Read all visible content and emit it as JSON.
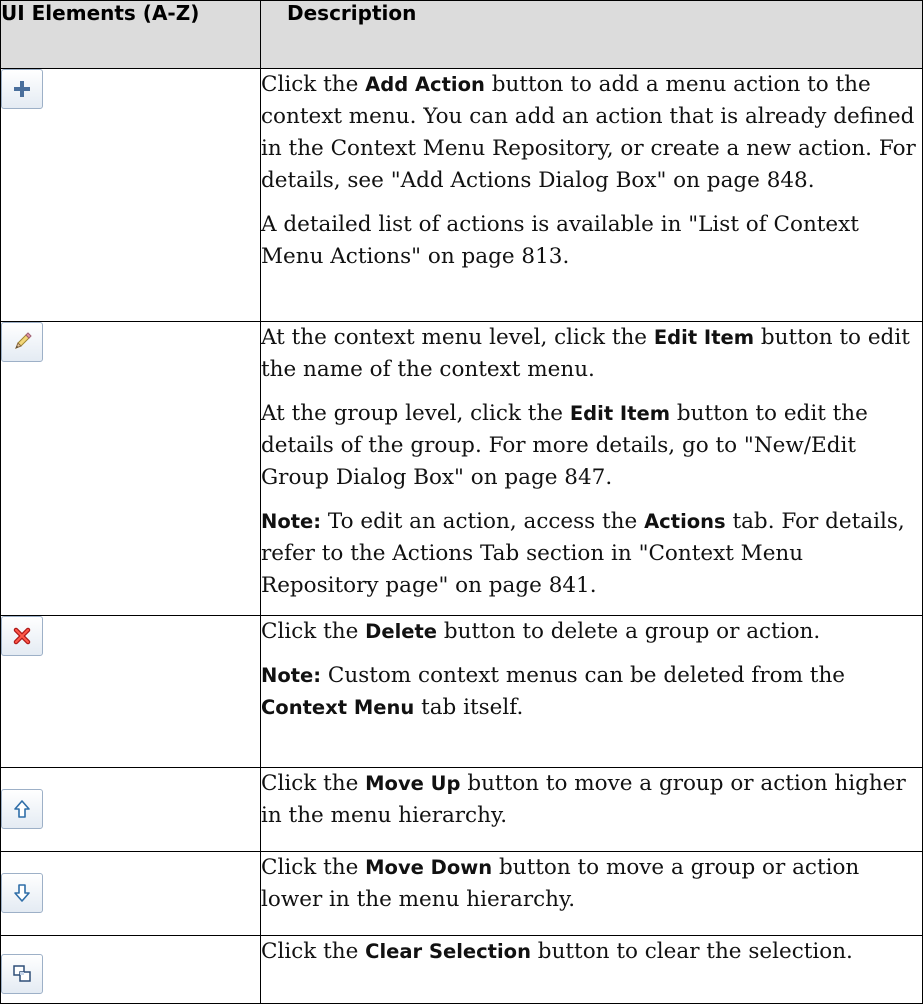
{
  "header": {
    "col1": "UI Elements (A-Z)",
    "col2": "Description"
  },
  "rows": [
    {
      "icon": "add-plus-icon",
      "paragraphs": [
        [
          {
            "t": "Click the "
          },
          {
            "t": "Add Action",
            "b": true
          },
          {
            "t": " button to add a menu action to the context menu. You can add an action that is already defined in the Context Menu Repository, or create a new action. For details, see \"Add Actions Dialog Box\" on page 848."
          }
        ],
        [
          {
            "t": "A detailed list of actions is available in \"List of Context Menu Actions\" on page 813."
          }
        ]
      ]
    },
    {
      "icon": "pencil-edit-icon",
      "paragraphs": [
        [
          {
            "t": "At the context menu level, click the "
          },
          {
            "t": "Edit Item",
            "b": true
          },
          {
            "t": " button to edit the name of the context menu."
          }
        ],
        [
          {
            "t": "At the group level, click the "
          },
          {
            "t": "Edit Item",
            "b": true
          },
          {
            "t": " button to edit the details of the group. For more details, go to \"New/Edit Group Dialog Box\" on page 847."
          }
        ],
        [
          {
            "t": "Note:",
            "b": true
          },
          {
            "t": " To edit an action, access the "
          },
          {
            "t": "Actions",
            "b": true
          },
          {
            "t": " tab. For details, refer to the Actions Tab section in \"Context Menu Repository page\" on page 841."
          }
        ]
      ]
    },
    {
      "icon": "delete-x-icon",
      "paragraphs": [
        [
          {
            "t": "Click the "
          },
          {
            "t": "Delete",
            "b": true
          },
          {
            "t": " button to delete a group or action."
          }
        ],
        [
          {
            "t": "Note:",
            "b": true
          },
          {
            "t": " Custom context menus can be deleted from the "
          },
          {
            "t": "Context Menu",
            "b": true
          },
          {
            "t": " tab itself."
          }
        ]
      ]
    },
    {
      "icon": "arrow-up-icon",
      "paragraphs": [
        [
          {
            "t": "Click the "
          },
          {
            "t": "Move Up",
            "b": true
          },
          {
            "t": " button to move a group or action higher in the menu hierarchy."
          }
        ]
      ]
    },
    {
      "icon": "arrow-down-icon",
      "paragraphs": [
        [
          {
            "t": "Click the "
          },
          {
            "t": "Move Down",
            "b": true
          },
          {
            "t": " button to move a group or action lower in the menu hierarchy."
          }
        ]
      ]
    },
    {
      "icon": "clear-selection-icon",
      "paragraphs": [
        [
          {
            "t": "Click the "
          },
          {
            "t": "Clear Selection",
            "b": true
          },
          {
            "t": " button to clear the selection."
          }
        ]
      ]
    }
  ]
}
